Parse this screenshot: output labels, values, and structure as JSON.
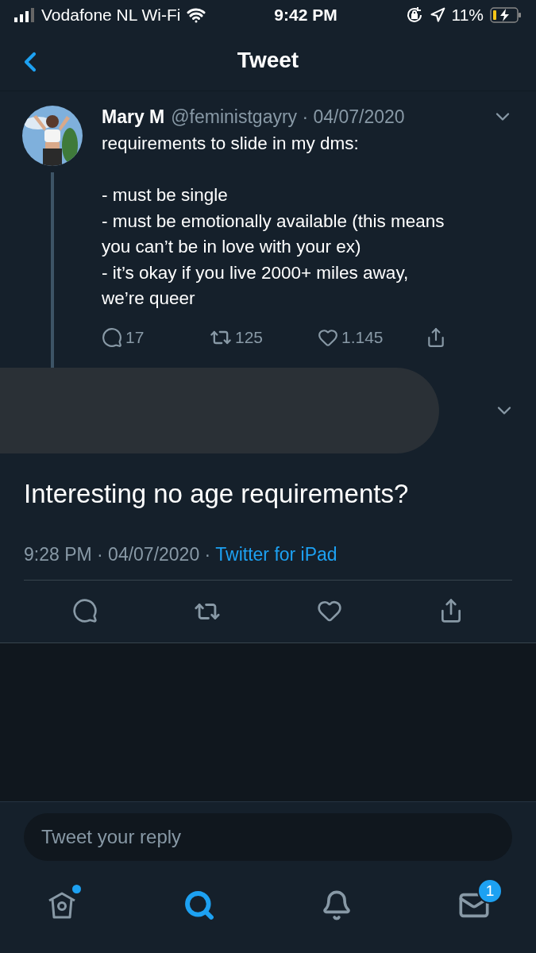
{
  "status_bar": {
    "carrier": "Vodafone NL Wi-Fi",
    "time": "9:42 PM",
    "battery": "11%"
  },
  "header": {
    "title": "Tweet"
  },
  "parent_tweet": {
    "name": "Mary M",
    "meta": "@feministgayry · 04/07/2020",
    "text": "requirements to slide in my dms:\n\n- must be single\n- must be emotionally available (this means\nyou can’t be in love with your ex)\n- it’s okay if you live 2000+ miles away,\nwe’re queer",
    "replies": "17",
    "retweets": "125",
    "likes": "1.145"
  },
  "reply_tweet": {
    "redacted": true,
    "text": "Interesting no age requirements?",
    "time": "9:28 PM · 04/07/2020 ·",
    "source": "Twitter for iPad"
  },
  "reply_field": {
    "placeholder": "Tweet your reply"
  },
  "tab_bar": [
    {
      "kind": "home",
      "selected": false,
      "dot": true
    },
    {
      "kind": "search",
      "selected": true
    },
    {
      "kind": "notifications",
      "selected": false
    },
    {
      "kind": "messages",
      "selected": false,
      "badge": "1"
    }
  ]
}
